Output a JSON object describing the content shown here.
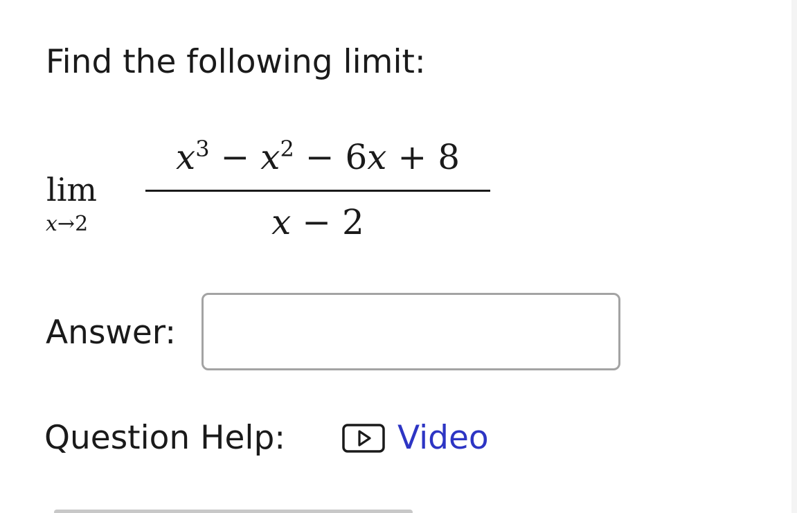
{
  "question": {
    "prompt": "Find the following limit:",
    "limit": {
      "operator": "lim",
      "subscript_var": "x",
      "subscript_arrow": "→",
      "subscript_value": "2",
      "numerator": {
        "t1_var": "x",
        "t1_exp": "3",
        "op1": " − ",
        "t2_var": "x",
        "t2_exp": "2",
        "op2": " − ",
        "t3_coef": "6",
        "t3_var": "x",
        "op3": " + ",
        "t4_const": "8"
      },
      "denominator": {
        "var": "x",
        "op": " − ",
        "const": "2"
      }
    }
  },
  "answer": {
    "label": "Answer:",
    "value": "",
    "placeholder": ""
  },
  "help": {
    "label": "Question Help:",
    "link_label": "Video",
    "icon": "video-play-icon"
  },
  "colors": {
    "text": "#1a1a1a",
    "link": "#2d35c4",
    "input_border": "#a3a3a3"
  }
}
